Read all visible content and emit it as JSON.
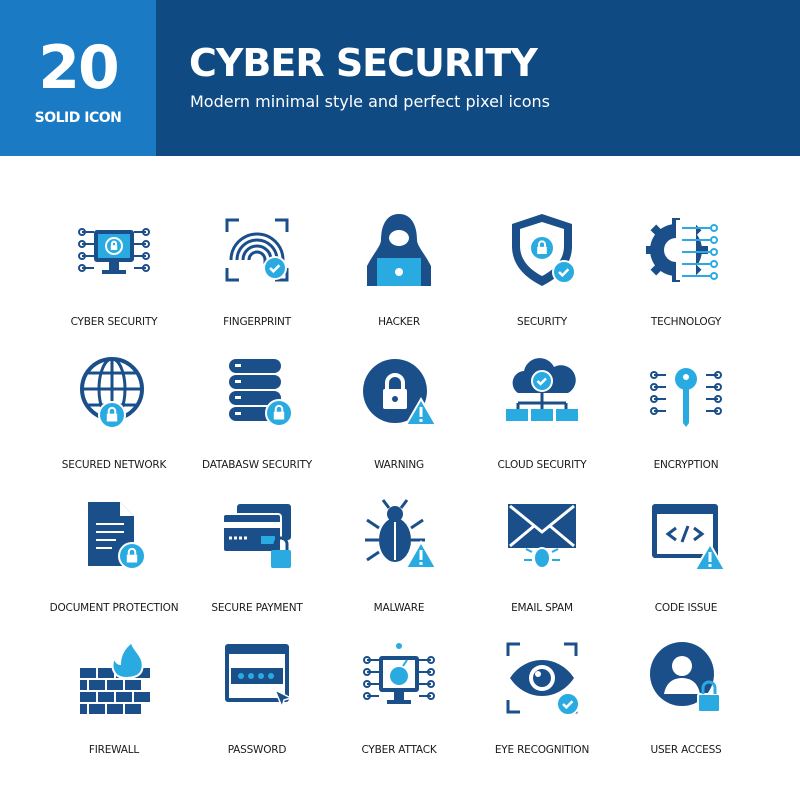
{
  "header": {
    "count": "20",
    "count_label": "SOLID ICON",
    "title": "CYBER SECURITY",
    "subtitle": "Modern minimal style and perfect pixel icons"
  },
  "colors": {
    "primary": "#1b4f8a",
    "accent": "#29abe2",
    "header_dark": "#0f4a82",
    "header_light": "#1a7bc4"
  },
  "icons": [
    {
      "label": "CYBER SECURITY",
      "icon": "monitor-lock-circuit-icon"
    },
    {
      "label": "FINGERPRINT",
      "icon": "fingerprint-check-icon"
    },
    {
      "label": "HACKER",
      "icon": "hooded-hacker-laptop-icon"
    },
    {
      "label": "SECURITY",
      "icon": "shield-lock-check-icon"
    },
    {
      "label": "TECHNOLOGY",
      "icon": "gear-circuit-icon"
    },
    {
      "label": "SECURED NETWORK",
      "icon": "globe-lock-icon"
    },
    {
      "label": "DATABASW SECURITY",
      "icon": "database-lock-icon"
    },
    {
      "label": "WARNING",
      "icon": "lock-warning-icon"
    },
    {
      "label": "CLOUD SECURITY",
      "icon": "cloud-lock-network-icon"
    },
    {
      "label": "ENCRYPTION",
      "icon": "key-circuit-icon"
    },
    {
      "label": "DOCUMENT PROTECTION",
      "icon": "document-lock-icon"
    },
    {
      "label": "SECURE PAYMENT",
      "icon": "credit-card-lock-icon"
    },
    {
      "label": "MALWARE",
      "icon": "bug-warning-icon"
    },
    {
      "label": "EMAIL SPAM",
      "icon": "envelope-bug-icon"
    },
    {
      "label": "CODE ISSUE",
      "icon": "code-window-warning-icon"
    },
    {
      "label": "FIREWALL",
      "icon": "brick-wall-fire-icon"
    },
    {
      "label": "PASSWORD",
      "icon": "password-window-cursor-icon"
    },
    {
      "label": "CYBER ATTACK",
      "icon": "monitor-bomb-icon"
    },
    {
      "label": "EYE RECOGNITION",
      "icon": "eye-scan-check-icon"
    },
    {
      "label": "USER ACCESS",
      "icon": "user-lock-icon"
    }
  ]
}
